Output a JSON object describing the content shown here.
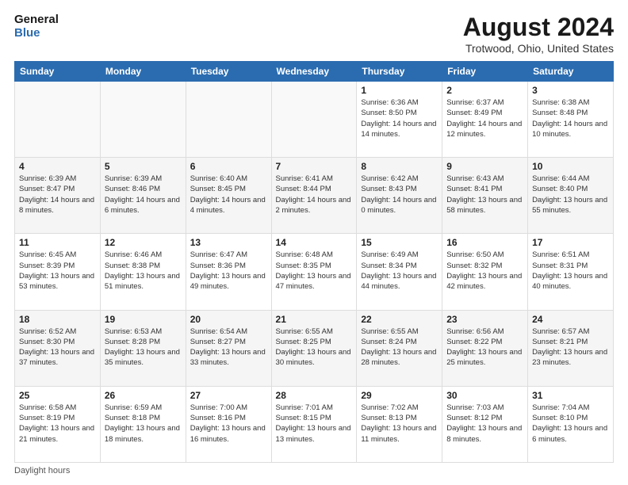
{
  "header": {
    "logo_line1": "General",
    "logo_line2": "Blue",
    "month_title": "August 2024",
    "location": "Trotwood, Ohio, United States"
  },
  "days_of_week": [
    "Sunday",
    "Monday",
    "Tuesday",
    "Wednesday",
    "Thursday",
    "Friday",
    "Saturday"
  ],
  "weeks": [
    [
      {
        "day": "",
        "sunrise": "",
        "sunset": "",
        "daylight": ""
      },
      {
        "day": "",
        "sunrise": "",
        "sunset": "",
        "daylight": ""
      },
      {
        "day": "",
        "sunrise": "",
        "sunset": "",
        "daylight": ""
      },
      {
        "day": "",
        "sunrise": "",
        "sunset": "",
        "daylight": ""
      },
      {
        "day": "1",
        "sunrise": "6:36 AM",
        "sunset": "8:50 PM",
        "daylight": "14 hours and 14 minutes."
      },
      {
        "day": "2",
        "sunrise": "6:37 AM",
        "sunset": "8:49 PM",
        "daylight": "14 hours and 12 minutes."
      },
      {
        "day": "3",
        "sunrise": "6:38 AM",
        "sunset": "8:48 PM",
        "daylight": "14 hours and 10 minutes."
      }
    ],
    [
      {
        "day": "4",
        "sunrise": "6:39 AM",
        "sunset": "8:47 PM",
        "daylight": "14 hours and 8 minutes."
      },
      {
        "day": "5",
        "sunrise": "6:39 AM",
        "sunset": "8:46 PM",
        "daylight": "14 hours and 6 minutes."
      },
      {
        "day": "6",
        "sunrise": "6:40 AM",
        "sunset": "8:45 PM",
        "daylight": "14 hours and 4 minutes."
      },
      {
        "day": "7",
        "sunrise": "6:41 AM",
        "sunset": "8:44 PM",
        "daylight": "14 hours and 2 minutes."
      },
      {
        "day": "8",
        "sunrise": "6:42 AM",
        "sunset": "8:43 PM",
        "daylight": "14 hours and 0 minutes."
      },
      {
        "day": "9",
        "sunrise": "6:43 AM",
        "sunset": "8:41 PM",
        "daylight": "13 hours and 58 minutes."
      },
      {
        "day": "10",
        "sunrise": "6:44 AM",
        "sunset": "8:40 PM",
        "daylight": "13 hours and 55 minutes."
      }
    ],
    [
      {
        "day": "11",
        "sunrise": "6:45 AM",
        "sunset": "8:39 PM",
        "daylight": "13 hours and 53 minutes."
      },
      {
        "day": "12",
        "sunrise": "6:46 AM",
        "sunset": "8:38 PM",
        "daylight": "13 hours and 51 minutes."
      },
      {
        "day": "13",
        "sunrise": "6:47 AM",
        "sunset": "8:36 PM",
        "daylight": "13 hours and 49 minutes."
      },
      {
        "day": "14",
        "sunrise": "6:48 AM",
        "sunset": "8:35 PM",
        "daylight": "13 hours and 47 minutes."
      },
      {
        "day": "15",
        "sunrise": "6:49 AM",
        "sunset": "8:34 PM",
        "daylight": "13 hours and 44 minutes."
      },
      {
        "day": "16",
        "sunrise": "6:50 AM",
        "sunset": "8:32 PM",
        "daylight": "13 hours and 42 minutes."
      },
      {
        "day": "17",
        "sunrise": "6:51 AM",
        "sunset": "8:31 PM",
        "daylight": "13 hours and 40 minutes."
      }
    ],
    [
      {
        "day": "18",
        "sunrise": "6:52 AM",
        "sunset": "8:30 PM",
        "daylight": "13 hours and 37 minutes."
      },
      {
        "day": "19",
        "sunrise": "6:53 AM",
        "sunset": "8:28 PM",
        "daylight": "13 hours and 35 minutes."
      },
      {
        "day": "20",
        "sunrise": "6:54 AM",
        "sunset": "8:27 PM",
        "daylight": "13 hours and 33 minutes."
      },
      {
        "day": "21",
        "sunrise": "6:55 AM",
        "sunset": "8:25 PM",
        "daylight": "13 hours and 30 minutes."
      },
      {
        "day": "22",
        "sunrise": "6:55 AM",
        "sunset": "8:24 PM",
        "daylight": "13 hours and 28 minutes."
      },
      {
        "day": "23",
        "sunrise": "6:56 AM",
        "sunset": "8:22 PM",
        "daylight": "13 hours and 25 minutes."
      },
      {
        "day": "24",
        "sunrise": "6:57 AM",
        "sunset": "8:21 PM",
        "daylight": "13 hours and 23 minutes."
      }
    ],
    [
      {
        "day": "25",
        "sunrise": "6:58 AM",
        "sunset": "8:19 PM",
        "daylight": "13 hours and 21 minutes."
      },
      {
        "day": "26",
        "sunrise": "6:59 AM",
        "sunset": "8:18 PM",
        "daylight": "13 hours and 18 minutes."
      },
      {
        "day": "27",
        "sunrise": "7:00 AM",
        "sunset": "8:16 PM",
        "daylight": "13 hours and 16 minutes."
      },
      {
        "day": "28",
        "sunrise": "7:01 AM",
        "sunset": "8:15 PM",
        "daylight": "13 hours and 13 minutes."
      },
      {
        "day": "29",
        "sunrise": "7:02 AM",
        "sunset": "8:13 PM",
        "daylight": "13 hours and 11 minutes."
      },
      {
        "day": "30",
        "sunrise": "7:03 AM",
        "sunset": "8:12 PM",
        "daylight": "13 hours and 8 minutes."
      },
      {
        "day": "31",
        "sunrise": "7:04 AM",
        "sunset": "8:10 PM",
        "daylight": "13 hours and 6 minutes."
      }
    ]
  ],
  "footer": {
    "note": "Daylight hours"
  }
}
